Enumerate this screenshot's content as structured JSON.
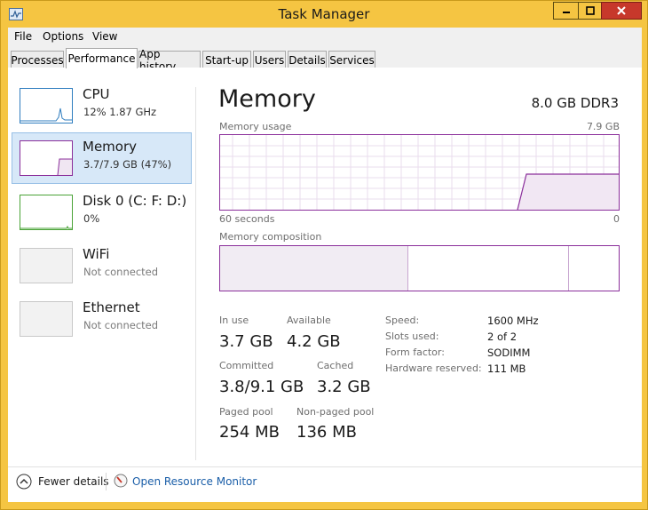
{
  "window": {
    "title": "Task Manager"
  },
  "menu": [
    "File",
    "Options",
    "View"
  ],
  "tabs": [
    "Processes",
    "Performance",
    "App history",
    "Start-up",
    "Users",
    "Details",
    "Services"
  ],
  "sidebar": [
    {
      "name": "CPU",
      "detail": "12%  1.87 GHz"
    },
    {
      "name": "Memory",
      "detail": "3.7/7.9 GB (47%)"
    },
    {
      "name": "Disk 0 (C: F: D:)",
      "detail": "0%"
    },
    {
      "name": "WiFi",
      "detail": "Not connected"
    },
    {
      "name": "Ethernet",
      "detail": "Not connected"
    }
  ],
  "main": {
    "heading": "Memory",
    "spec": "8.0 GB DDR3",
    "usage_label": "Memory usage",
    "usage_max": "7.9 GB",
    "time_span": "60 seconds",
    "time_end": "0",
    "composition_label": "Memory composition",
    "composition": {
      "in_use_fraction": 0.47,
      "standby_fraction": 0.4
    },
    "stats": {
      "in_use": {
        "label": "In use",
        "value": "3.7 GB"
      },
      "available": {
        "label": "Available",
        "value": "4.2 GB"
      },
      "committed": {
        "label": "Committed",
        "value": "3.8/9.1 GB"
      },
      "cached": {
        "label": "Cached",
        "value": "3.2 GB"
      },
      "paged_pool": {
        "label": "Paged pool",
        "value": "254 MB"
      },
      "non_paged_pool": {
        "label": "Non-paged pool",
        "value": "136 MB"
      }
    },
    "details": [
      {
        "label": "Speed:",
        "value": "1600 MHz"
      },
      {
        "label": "Slots used:",
        "value": "2 of 2"
      },
      {
        "label": "Form factor:",
        "value": "SODIMM"
      },
      {
        "label": "Hardware reserved:",
        "value": "111 MB"
      }
    ]
  },
  "footer": {
    "fewer_details": "Fewer details",
    "resource_monitor": "Open Resource Monitor"
  },
  "colors": {
    "memory": "#8b2f9b",
    "cpu": "#2f7dbf",
    "disk": "#4aa337",
    "titlebar": "#f5c542",
    "close": "#c7382b"
  }
}
